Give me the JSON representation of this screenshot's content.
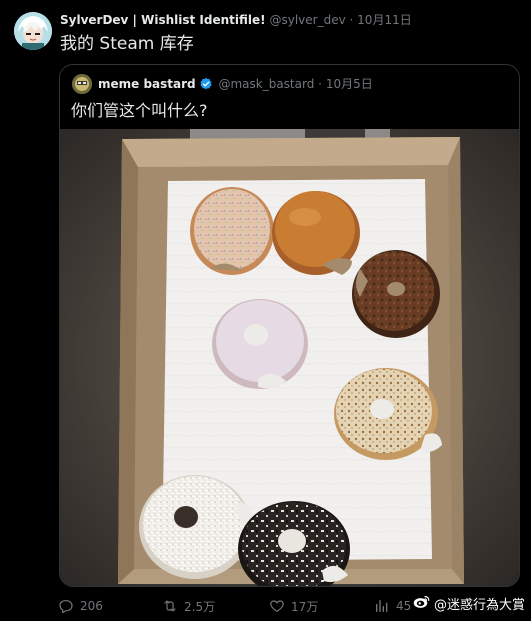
{
  "tweet": {
    "author_name": "SylverDev | Wishlist Identifile!",
    "author_handle": "@sylver_dev",
    "separator": "·",
    "date": "10月11日",
    "text": "我的 Steam 库存"
  },
  "quoted_tweet": {
    "author_name": "meme bastard",
    "author_handle": "@mask_bastard",
    "separator": "·",
    "date": "10月5日",
    "text": "你们管这个叫什么?",
    "verified_icon": "verified-badge-icon",
    "image_subject": "box-of-donuts-photo"
  },
  "actions": {
    "reply_count": "206",
    "repost_count": "2.5万",
    "like_count": "17万",
    "views_count": "45",
    "reply_icon": "reply-icon",
    "repost_icon": "repost-icon",
    "like_icon": "heart-icon",
    "views_icon": "views-bars-icon"
  },
  "watermark": {
    "text": "@迷惑行為大賞",
    "icon": "weibo-icon"
  },
  "colors": {
    "background": "#000000",
    "primary_text": "#e7e9ea",
    "secondary_text": "#71767b",
    "border": "#2f3336",
    "verified": "#1d9bf0"
  }
}
